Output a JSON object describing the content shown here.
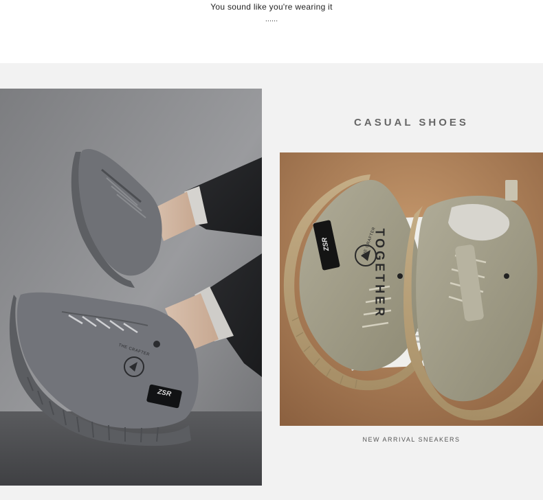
{
  "header": {
    "tagline": "You sound like you're wearing it",
    "ellipsis": "......"
  },
  "section": {
    "title": "CASUAL SHOES",
    "caption": "NEW ARRIVAL SNEAKERS"
  },
  "left_photo": {
    "shoe_color": "#6f7176",
    "background_color": "#8f9093",
    "floor_color": "#4e4f52",
    "badge_text": "ZSR",
    "emblem_text": "THE CRAFTER"
  },
  "right_photo": {
    "shoe_color": "#a39f8a",
    "sole_color": "#b9a27a",
    "background_color": "#b3865b",
    "book_text": "TOGETHER",
    "badge_text": "ZSR",
    "emblem_text": "THE CRAFTER"
  }
}
